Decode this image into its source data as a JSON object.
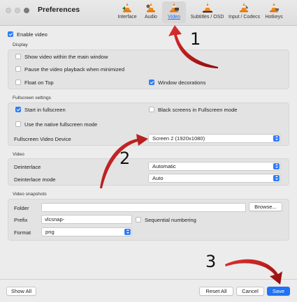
{
  "window": {
    "title": "Preferences"
  },
  "tabs": [
    {
      "label": "Interface",
      "icon": "interface-cone-icon"
    },
    {
      "label": "Audio",
      "icon": "audio-cone-icon"
    },
    {
      "label": "Video",
      "icon": "video-cone-icon",
      "active": true
    },
    {
      "label": "Subtitles / OSD",
      "icon": "subtitles-cone-icon"
    },
    {
      "label": "Input / Codecs",
      "icon": "input-cone-icon"
    },
    {
      "label": "Hotkeys",
      "icon": "hotkeys-cone-icon"
    }
  ],
  "enable_video": {
    "label": "Enable video",
    "checked": true
  },
  "display": {
    "title": "Display",
    "show_in_main": {
      "label": "Show video within the main window",
      "checked": false
    },
    "pause_minimized": {
      "label": "Pause the video playback when minimized",
      "checked": false
    },
    "float_on_top": {
      "label": "Float on Top",
      "checked": false
    },
    "window_decorations": {
      "label": "Window decorations",
      "checked": true
    }
  },
  "fullscreen": {
    "title": "Fullscreen settings",
    "start_fullscreen": {
      "label": "Start in fullscreen",
      "checked": true
    },
    "black_screens": {
      "label": "Black screens in Fullscreen mode",
      "checked": false
    },
    "native_fullscreen": {
      "label": "Use the native fullscreen mode",
      "checked": false
    },
    "device_label": "Fullscreen Video Device",
    "device_value": "Screen 2 (1920x1080)"
  },
  "video": {
    "title": "Video",
    "deinterlace_label": "Deinterlace",
    "deinterlace_value": "Automatic",
    "deinterlace_mode_label": "Deinterlace mode",
    "deinterlace_mode_value": "Auto"
  },
  "snapshots": {
    "title": "Video snapshots",
    "folder_label": "Folder",
    "folder_value": "",
    "browse_label": "Browse...",
    "prefix_label": "Prefix",
    "prefix_value": "vlcsnap-",
    "sequential": {
      "label": "Sequential numbering",
      "checked": false
    },
    "format_label": "Format",
    "format_value": "png"
  },
  "footer": {
    "show_all": "Show All",
    "reset_all": "Reset All",
    "cancel": "Cancel",
    "save": "Save"
  },
  "annotations": [
    "1",
    "2",
    "3"
  ],
  "colors": {
    "accent": "#2f7cf6",
    "arrow": "#b01414"
  }
}
